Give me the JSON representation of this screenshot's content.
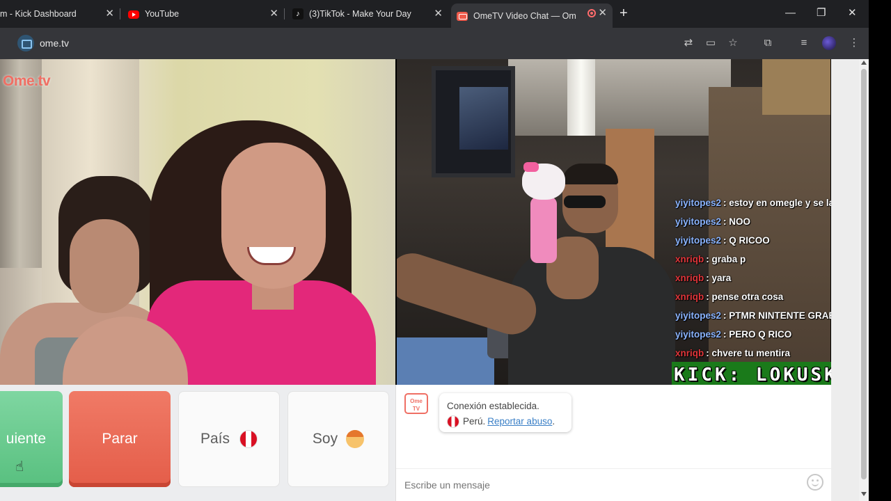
{
  "browser": {
    "tabs": [
      {
        "label": "m - Kick Dashboard",
        "icon": "kick-icon",
        "active": false
      },
      {
        "label": "YouTube",
        "icon": "youtube-icon",
        "active": false
      },
      {
        "label": "(3)TikTok - Make Your Day",
        "icon": "tiktok-icon",
        "active": false
      },
      {
        "label": "OmeTV Video Chat — Ome",
        "icon": "ometv-icon",
        "active": true,
        "recording": true
      }
    ],
    "new_tab": "+",
    "window_controls": {
      "minimize": "—",
      "maximize": "❐",
      "close": "✕"
    },
    "url": "ome.tv",
    "close_glyph": "✕"
  },
  "left_video": {
    "watermark": "Ome.tv"
  },
  "overlay_chat": {
    "messages": [
      {
        "user": "yiyitopes2",
        "text": ": estoy en omegle y se la esta chupar",
        "color": "#8ab4ff"
      },
      {
        "user": "yiyitopes2",
        "text": ": NOO",
        "color": "#8ab4ff"
      },
      {
        "user": "yiyitopes2",
        "text": ": Q RICOO",
        "color": "#8ab4ff"
      },
      {
        "user": "xnriqb",
        "text": ": graba p",
        "color": "#e0353a"
      },
      {
        "user": "xnriqb",
        "text": ": yara",
        "color": "#e0353a"
      },
      {
        "user": "xnriqb",
        "text": ": pense otra cosa",
        "color": "#e0353a"
      },
      {
        "user": "yiyitopes2",
        "text": ": PTMR NINTENTE GRABAR Y SE SA",
        "color": "#8ab4ff"
      },
      {
        "user": "yiyitopes2",
        "text": ": PERO Q RICO",
        "color": "#8ab4ff"
      },
      {
        "user": "xnriqb",
        "text": ": chvere tu mentira",
        "color": "#e0353a"
      }
    ],
    "kick_banner": "KICK: LOKUSKU"
  },
  "controls": {
    "next_label": "uiente",
    "stop_label": "Parar",
    "country_label": "País",
    "gender_label": "Soy"
  },
  "chat": {
    "avatar_text": "Ome TV",
    "status": "Conexión establecida.",
    "country": "Perú.",
    "report_link": "Reportar abuso",
    "report_suffix": ".",
    "input_placeholder": "Escribe un mensaje"
  }
}
